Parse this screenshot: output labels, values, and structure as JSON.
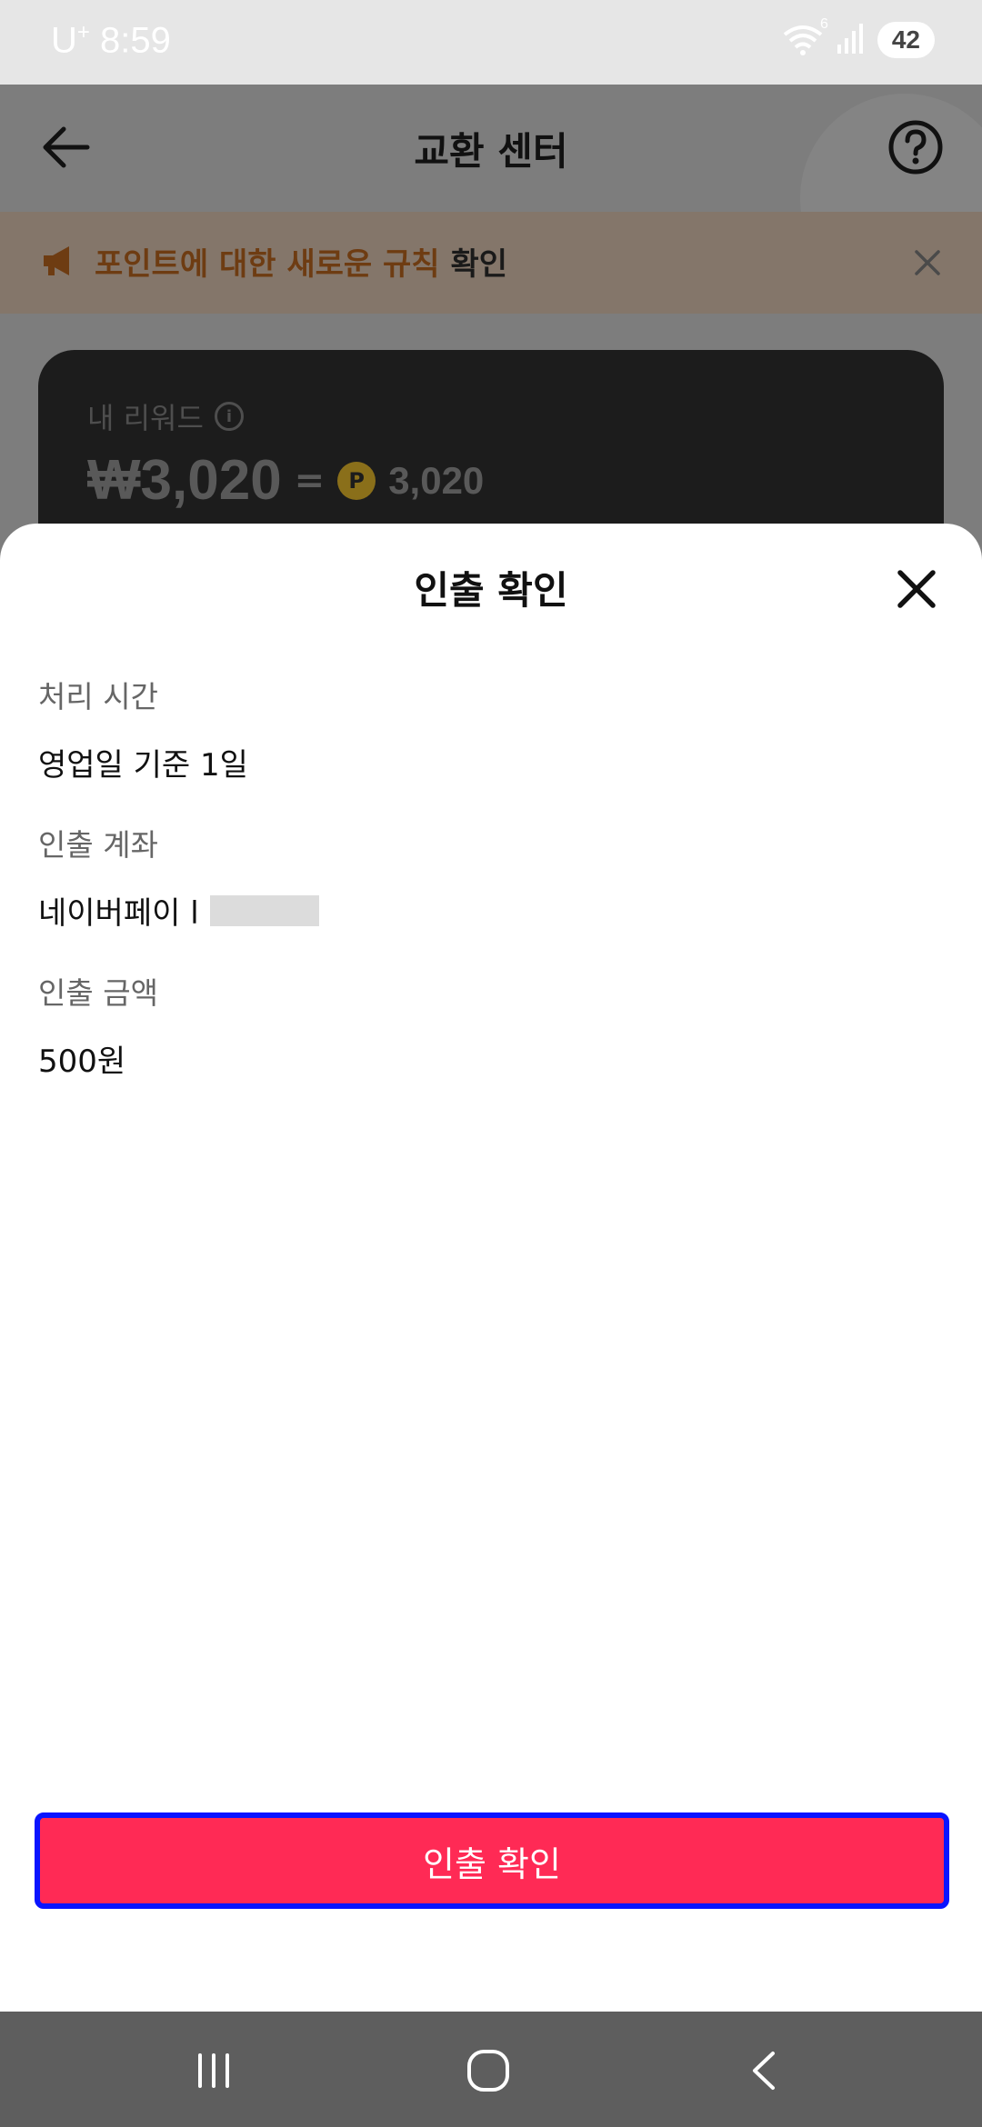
{
  "status_bar": {
    "carrier": "U",
    "carrier_sup": "+",
    "time": "8:59",
    "battery": "42",
    "wifi_label": "6"
  },
  "background_screen": {
    "title": "교환 센터",
    "notice_text": "포인트에 대한 새로운 규칙",
    "notice_link": "확인",
    "reward_label": "내 리워드",
    "reward_amount": "₩3,020",
    "equals": "=",
    "coin_symbol": "P",
    "reward_points": "3,020"
  },
  "sheet": {
    "title": "인출 확인",
    "fields": [
      {
        "label": "처리 시간",
        "value": "영업일 기준 1일"
      },
      {
        "label": "인출 계좌",
        "value": "네이버페이 l"
      },
      {
        "label": "인출 금액",
        "value": "500원"
      }
    ],
    "confirm_button": "인출 확인"
  },
  "colors": {
    "accent": "#ff2a55",
    "highlight_border": "#0a14ff",
    "overlay": "#7d7d7d",
    "nav_bar": "#5e5e5e"
  },
  "icons": {
    "back": "arrow-left-icon",
    "help": "question-circle-icon",
    "notice": "megaphone-icon",
    "notice_close": "close-icon",
    "sheet_close": "close-icon",
    "nav_recents": "recents-icon",
    "nav_home": "home-icon",
    "nav_back": "chevron-left-icon"
  }
}
